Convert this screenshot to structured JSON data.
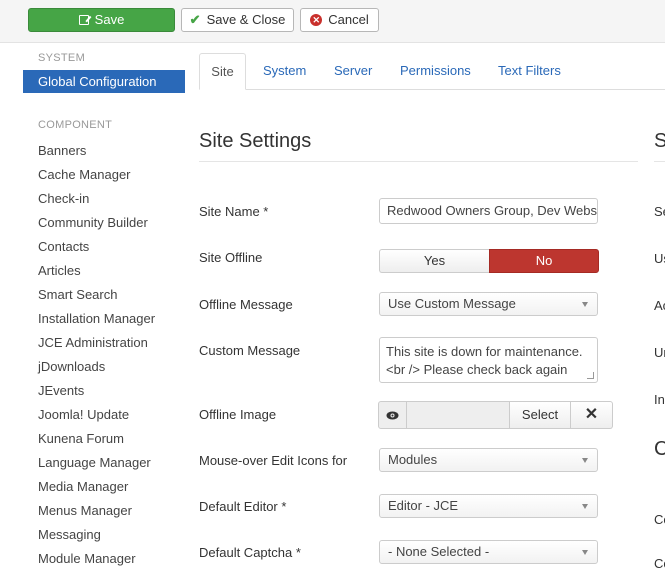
{
  "toolbar": {
    "save_label": "Save",
    "save_close_label": "Save & Close",
    "cancel_label": "Cancel"
  },
  "sidebar": {
    "system_heading": "SYSTEM",
    "active_item": "Global Configuration",
    "component_heading": "COMPONENT",
    "items": [
      "Banners",
      "Cache Manager",
      "Check-in",
      "Community Builder",
      "Contacts",
      "Articles",
      "Smart Search",
      "Installation Manager",
      "JCE Administration",
      "jDownloads",
      "JEvents",
      "Joomla! Update",
      "Kunena Forum",
      "Language Manager",
      "Media Manager",
      "Menus Manager",
      "Messaging",
      "Module Manager"
    ]
  },
  "tabs": [
    "Site",
    "System",
    "Server",
    "Permissions",
    "Text Filters"
  ],
  "main": {
    "section_title": "Site Settings",
    "site_name_label": "Site Name *",
    "site_name_value": "Redwood Owners Group, Dev Website",
    "site_offline_label": "Site Offline",
    "toggle_yes": "Yes",
    "toggle_no": "No",
    "offline_message_label": "Offline Message",
    "offline_message_value": "Use Custom Message",
    "custom_message_label": "Custom Message",
    "custom_message_line1": "This site is down for maintenance.",
    "custom_message_line2": "<br /> Please check back again",
    "offline_image_label": "Offline Image",
    "select_label": "Select",
    "clear_label": "✕",
    "mouseover_label": "Mouse-over Edit Icons for",
    "mouseover_value": "Modules",
    "default_editor_label": "Default Editor *",
    "default_editor_value": "Editor - JCE",
    "default_captcha_label": "Default Captcha *",
    "default_captcha_value": "- None Selected -"
  },
  "right_column": {
    "section_title": "S",
    "labels": [
      "Se",
      "Us",
      "Ac",
      "Ur",
      "In"
    ],
    "section_title2": "C",
    "labels2": [
      "Co",
      "Co"
    ]
  },
  "colors": {
    "save_green": "#46a546",
    "active_blue": "#2a69b8",
    "toggle_no_red": "#bd362f"
  }
}
